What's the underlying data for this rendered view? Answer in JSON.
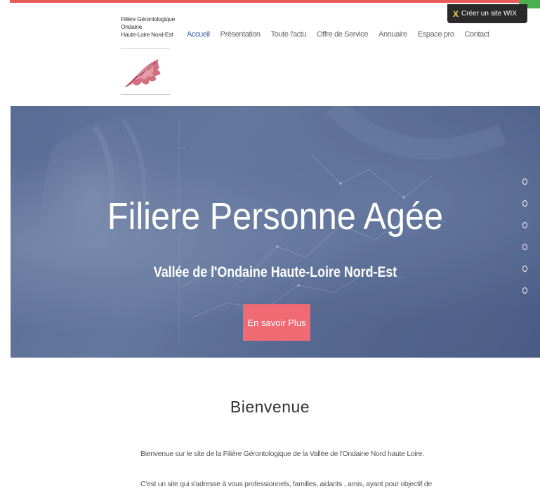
{
  "header": {
    "logo_lines": [
      "Filière Gérontologique",
      "Ondaine",
      "Haute-Loire Nord-Est"
    ],
    "wix_badge": "Créer un site WIX"
  },
  "nav": {
    "items": [
      {
        "label": "Accueil",
        "active": true
      },
      {
        "label": "Présentation",
        "active": false
      },
      {
        "label": "Toute l'actu",
        "active": false
      },
      {
        "label": "Offre de Service",
        "active": false
      },
      {
        "label": "Annuaire",
        "active": false
      },
      {
        "label": "Espace pro",
        "active": false
      },
      {
        "label": "Contact",
        "active": false
      }
    ]
  },
  "hero": {
    "title": "Filiere Personne Agée",
    "subtitle": "Vallée de l'Ondaine Haute-Loire Nord-Est",
    "cta": "En savoir Plus",
    "slide_count": 6
  },
  "welcome": {
    "title": "Bienvenue",
    "paragraph1": "Bienvenue sur le site de la Filière Gérontologique de la Vallée de l'Ondaine Nord haute Loire.",
    "paragraph2": "C'est un site qui s'adresse à vous professionnels, familles, aidants , amis, ayant pour objectif de"
  },
  "colors": {
    "accent": "#ef6a72",
    "nav_active": "#3a5fa8",
    "hero_overlay": "#5f739b"
  }
}
